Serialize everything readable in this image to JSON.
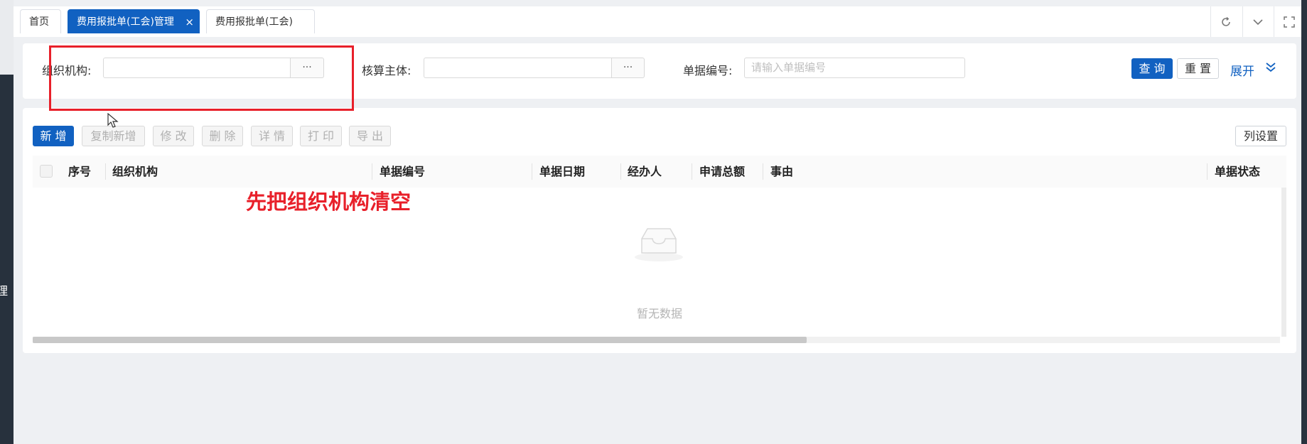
{
  "sidebar": {
    "fragment_text": "理"
  },
  "tabs": [
    {
      "label": "首页",
      "active": false
    },
    {
      "label": "费用报批单(工会)管理",
      "active": true,
      "close": "×"
    },
    {
      "label": "费用报批单(工会)",
      "active": false
    }
  ],
  "tab_tools": {
    "refresh_icon": "refresh-icon",
    "dropdown_icon": "chevron-down-icon",
    "fullscreen_icon": "fullscreen-icon"
  },
  "search": {
    "org_label": "组织机构:",
    "org_value": "",
    "org_picker": "···",
    "entity_label": "核算主体:",
    "entity_value": "",
    "entity_picker": "···",
    "doc_no_label": "单据编号:",
    "doc_no_placeholder": "请输入单据编号",
    "query_button": "查 询",
    "reset_button": "重 置",
    "expand_link": "展开",
    "expand_icon": "double-chevron-down-icon"
  },
  "toolbar": {
    "add": "新 增",
    "copy_add": "复制新增",
    "edit": "修 改",
    "delete": "删 除",
    "detail": "详 情",
    "print": "打 印",
    "export": "导 出",
    "column_settings": "列设置"
  },
  "table": {
    "columns": [
      "序号",
      "组织机构",
      "单据编号",
      "单据日期",
      "经办人",
      "申请总额",
      "事由",
      "单据状态"
    ],
    "rows": [],
    "empty_text": "暂无数据",
    "empty_icon": "empty-inbox-icon"
  },
  "annotation": {
    "text": "先把组织机构清空"
  },
  "colors": {
    "primary": "#1161c1",
    "annotation_red": "#e8202a",
    "page_bg": "#eef0f3",
    "sidebar_dark": "#27313d"
  }
}
